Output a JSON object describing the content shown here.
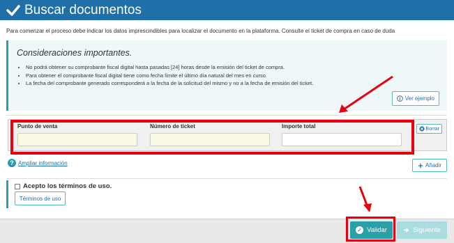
{
  "header": {
    "title": "Buscar documentos"
  },
  "intro": "Para comenzar el proceso debe indicar los datos imprescindibles para localizar el documento en la plataforma. Consulte el ticket de compra en caso de duda",
  "considerations": {
    "title": "Consideraciones importantes.",
    "items": [
      "No podrá obtener su comprobante fiscal digital hasta pasadas [24] horas desde la emisión del ticket de compra.",
      "Para obtener el comprobante fiscal digital tiene como fecha límite el último día natural del mes en curso.",
      "La fecha del comprobante generado corresponderá a la fecha de la solicitud del mismo y no a la fecha de emisión del ticket."
    ],
    "example_button": "Ver ejemplo"
  },
  "form": {
    "fields": [
      {
        "label": "Punto de venta",
        "value": ""
      },
      {
        "label": "Número de ticket",
        "value": ""
      },
      {
        "label": "Importe total",
        "value": ""
      }
    ],
    "clear_button": "Borrar"
  },
  "more_info": "Ampliar información",
  "add_button": "Añadir",
  "terms": {
    "accept_label": "Acepto los términos de uso.",
    "checked": false,
    "button": "Términos de uso"
  },
  "footer": {
    "validate_button": "Validar",
    "next_button": "Siguiente"
  },
  "colors": {
    "header": "#1f6fa8",
    "accent": "#2aa0a8",
    "highlight": "#e8000f",
    "disabled": "#a9dde0"
  }
}
